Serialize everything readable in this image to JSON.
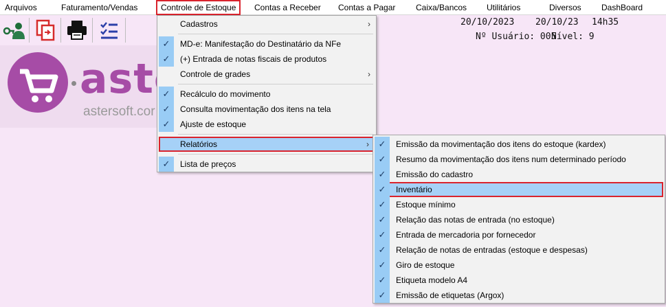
{
  "menubar": {
    "items": [
      "Arquivos",
      "Faturamento/Vendas",
      "Controle de Estoque",
      "Contas a Receber",
      "Contas a Pagar",
      "Caixa/Bancos",
      "Utilitários",
      "Diversos",
      "DashBoard"
    ]
  },
  "toolbar": {
    "icons": [
      "user-key-icon",
      "copy-document-icon",
      "printer-icon",
      "checklist-icon"
    ]
  },
  "logo": {
    "text": "aste",
    "url": "astersoft.cor"
  },
  "status": {
    "date1": "20/10/2023",
    "date2": "20/10/23",
    "time": "14h35",
    "user": "Nº Usuário: 005",
    "level": "Nível: 9"
  },
  "estoque_menu": {
    "items": [
      {
        "label": "Cadastros",
        "checked": false,
        "submenu": true
      },
      {
        "label": "MD-e: Manifestação do Destinatário da NFe",
        "checked": true
      },
      {
        "label": "(+) Entrada de notas fiscais de produtos",
        "checked": true
      },
      {
        "label": "Controle de grades",
        "checked": false,
        "submenu": true
      },
      {
        "label": "Recálculo do movimento",
        "checked": true
      },
      {
        "label": "Consulta movimentação dos itens na tela",
        "checked": true
      },
      {
        "label": "Ajuste de estoque",
        "checked": true
      },
      {
        "label": "Relatórios",
        "checked": false,
        "submenu": true,
        "highlighted": true
      },
      {
        "label": "Lista de preços",
        "checked": true
      }
    ]
  },
  "relatorios_menu": {
    "items": [
      {
        "label": "Emissão da movimentação dos itens do estoque (kardex)",
        "checked": true
      },
      {
        "label": "Resumo da movimentação dos itens num determinado período",
        "checked": true
      },
      {
        "label": "Emissão do cadastro",
        "checked": true
      },
      {
        "label": "Inventário",
        "checked": true,
        "highlighted": true
      },
      {
        "label": "Estoque mínimo",
        "checked": true
      },
      {
        "label": "Relação das notas de entrada (no estoque)",
        "checked": true
      },
      {
        "label": "Entrada de mercadoria por fornecedor",
        "checked": true
      },
      {
        "label": "Relação de notas de entradas (estoque e despesas)",
        "checked": true
      },
      {
        "label": "Giro de estoque",
        "checked": true
      },
      {
        "label": "Etiqueta modelo A4",
        "checked": true
      },
      {
        "label": "Emissão de etiquetas (Argox)",
        "checked": true
      }
    ]
  },
  "colors": {
    "highlight": "#a6d1f7",
    "check_bg": "#99ccf5",
    "red_box": "#d9232d",
    "brand": "#a64ca6",
    "background": "#f7e6f7"
  }
}
